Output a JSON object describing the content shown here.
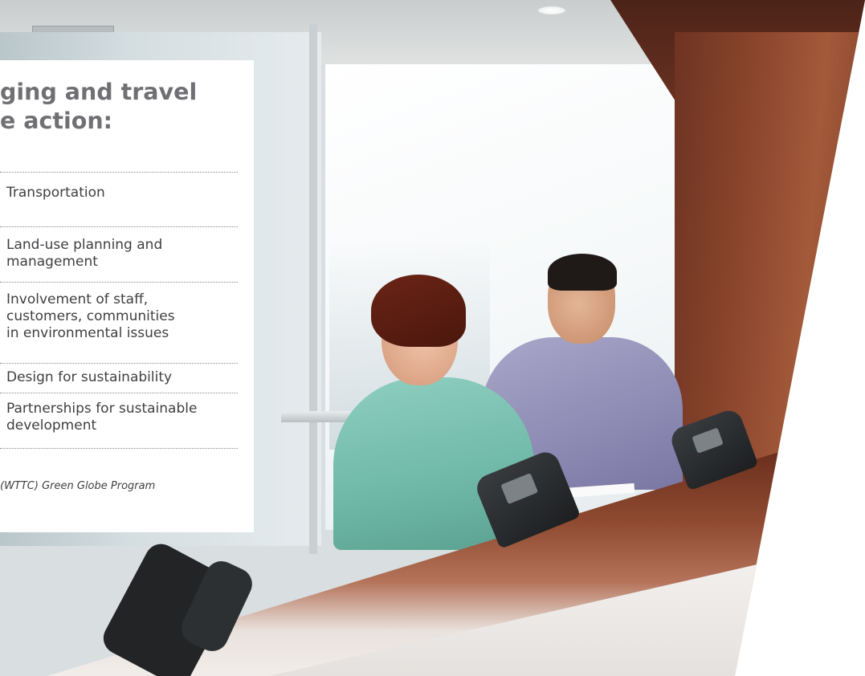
{
  "page": {
    "heading_lines": [
      "ging and travel",
      "e action:"
    ],
    "action_areas": [
      {
        "label": "Transportation"
      },
      {
        "label": "Land-use planning and\nmanagement"
      },
      {
        "label": "Involvement of staff,\ncustomers, communities\nin environmental issues"
      },
      {
        "label": "Design for sustainability"
      },
      {
        "label": "Partnerships for sustainable\ndevelopment"
      }
    ],
    "source": "(WTTC) Green Globe Program"
  },
  "photo": {
    "subject": "office-reception-desk-photo",
    "colors": {
      "wood": "#8a452c",
      "woman_top": "#6fb8a7",
      "man_shirt": "#8d8ab4",
      "counter": "#f3f1ef"
    }
  }
}
